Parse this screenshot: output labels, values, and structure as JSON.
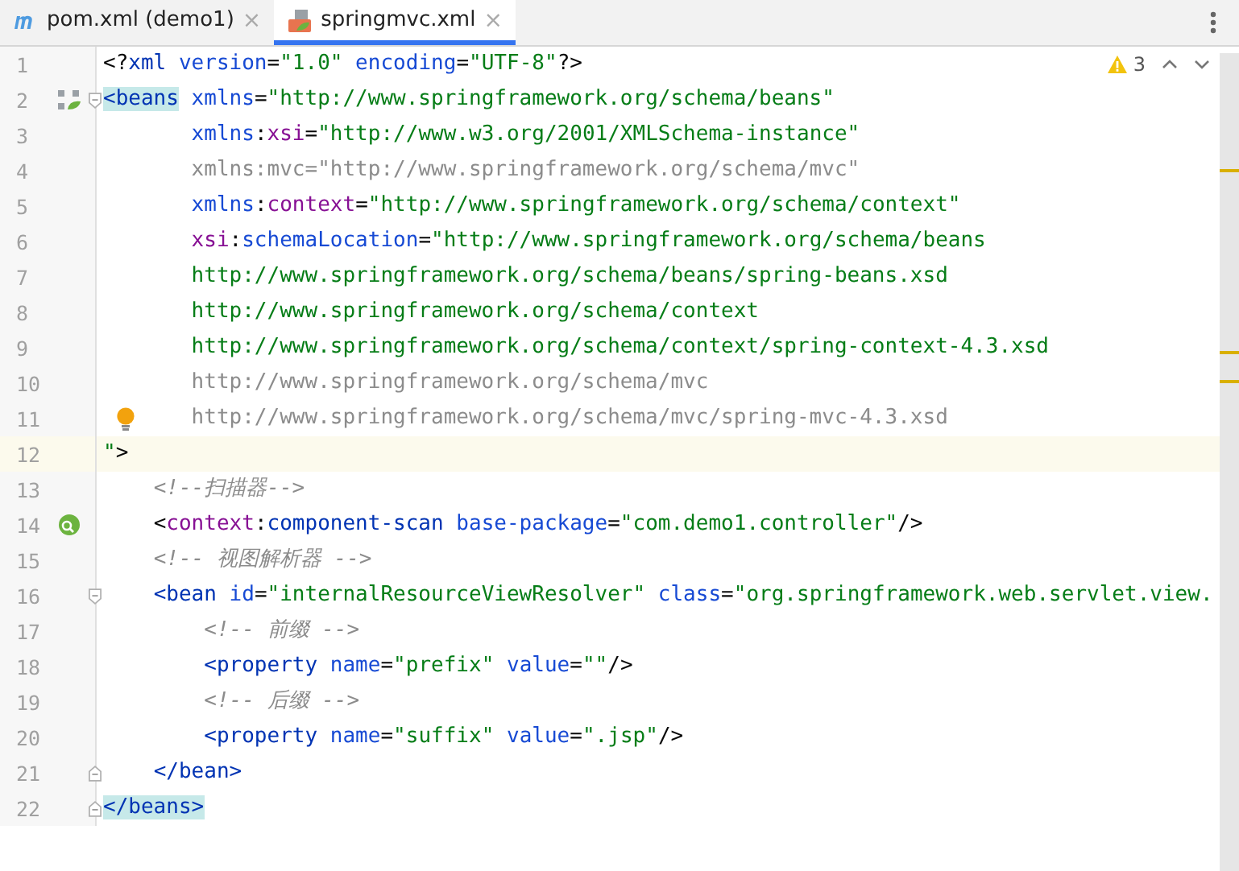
{
  "tabs": [
    {
      "label": "pom.xml (demo1)",
      "kind": "maven",
      "close": "×",
      "selected": false
    },
    {
      "label": "springmvc.xml",
      "kind": "xml",
      "close": "×",
      "selected": true
    }
  ],
  "inspection": {
    "warnings": "3"
  },
  "lines": [
    {
      "number": "1",
      "tokens": [
        {
          "kind": "punct",
          "text": "<?"
        },
        {
          "kind": "tag",
          "text": "xml"
        },
        {
          "kind": "attr",
          "text": " version"
        },
        {
          "kind": "punct",
          "text": "="
        },
        {
          "kind": "value",
          "text": "\"1.0\""
        },
        {
          "kind": "attr",
          "text": " encoding"
        },
        {
          "kind": "punct",
          "text": "="
        },
        {
          "kind": "value",
          "text": "\"UTF-8\""
        },
        {
          "kind": "punct",
          "text": "?>"
        }
      ]
    },
    {
      "number": "2",
      "gutter": {
        "kind": "bean"
      },
      "fold": {
        "kind": "start"
      },
      "tokens": [
        {
          "kind": "tag_match",
          "text": "<beans"
        },
        {
          "kind": "attr",
          "text": " xmlns"
        },
        {
          "kind": "punct",
          "text": "="
        },
        {
          "kind": "value",
          "text": "\"http://www.springframework.org/schema/beans\""
        }
      ]
    },
    {
      "number": "3",
      "tokens": [
        {
          "kind": "attr",
          "text": "       xmlns"
        },
        {
          "kind": "punct",
          "text": ":"
        },
        {
          "kind": "ns",
          "text": "xsi"
        },
        {
          "kind": "punct",
          "text": "="
        },
        {
          "kind": "value",
          "text": "\"http://www.w3.org/2001/XMLSchema-instance\""
        }
      ]
    },
    {
      "number": "4",
      "tokens": [
        {
          "kind": "unused",
          "text": "       xmlns:mvc=\"http://www.springframework.org/schema/mvc\""
        }
      ]
    },
    {
      "number": "5",
      "tokens": [
        {
          "kind": "attr",
          "text": "       xmlns"
        },
        {
          "kind": "punct",
          "text": ":"
        },
        {
          "kind": "ns",
          "text": "context"
        },
        {
          "kind": "punct",
          "text": "="
        },
        {
          "kind": "value",
          "text": "\"http://www.springframework.org/schema/context\""
        }
      ]
    },
    {
      "number": "6",
      "tokens": [
        {
          "kind": "ns",
          "text": "       xsi"
        },
        {
          "kind": "punct",
          "text": ":"
        },
        {
          "kind": "attr",
          "text": "schemaLocation"
        },
        {
          "kind": "punct",
          "text": "="
        },
        {
          "kind": "value",
          "text": "\"http://www.springframework.org/schema/beans"
        }
      ]
    },
    {
      "number": "7",
      "tokens": [
        {
          "kind": "value",
          "text": "       http://www.springframework.org/schema/beans/spring-beans.xsd"
        }
      ]
    },
    {
      "number": "8",
      "tokens": [
        {
          "kind": "value",
          "text": "       http://www.springframework.org/schema/context"
        }
      ]
    },
    {
      "number": "9",
      "tokens": [
        {
          "kind": "value",
          "text": "       http://www.springframework.org/schema/context/spring-context-4.3.xsd"
        }
      ]
    },
    {
      "number": "10",
      "tokens": [
        {
          "kind": "unused",
          "text": "       http://www.springframework.org/schema/mvc"
        }
      ]
    },
    {
      "number": "11",
      "gutter": {
        "kind": "bulb"
      },
      "tokens": [
        {
          "kind": "unused",
          "text": "       http://www.springframework.org/schema/mvc/spring-mvc-4.3.xsd"
        }
      ]
    },
    {
      "number": "12",
      "current": true,
      "tokens": [
        {
          "kind": "value",
          "text": "\""
        },
        {
          "kind": "punct",
          "text": ">"
        }
      ]
    },
    {
      "number": "13",
      "tokens": [
        {
          "kind": "comment",
          "text": "    <!--扫描器-->"
        }
      ]
    },
    {
      "number": "14",
      "gutter": {
        "kind": "scan"
      },
      "tokens": [
        {
          "kind": "punct",
          "text": "    <"
        },
        {
          "kind": "ns",
          "text": "context"
        },
        {
          "kind": "punct",
          "text": ":"
        },
        {
          "kind": "tag",
          "text": "component-scan"
        },
        {
          "kind": "attr",
          "text": " base-package"
        },
        {
          "kind": "punct",
          "text": "="
        },
        {
          "kind": "value",
          "text": "\"com.demo1.controller\""
        },
        {
          "kind": "punct",
          "text": "/>"
        }
      ]
    },
    {
      "number": "15",
      "tokens": [
        {
          "kind": "comment",
          "text": "    <!-- 视图解析器 -->"
        }
      ]
    },
    {
      "number": "16",
      "fold": {
        "kind": "start"
      },
      "tokens": [
        {
          "kind": "tag",
          "text": "    <bean"
        },
        {
          "kind": "attr",
          "text": " id"
        },
        {
          "kind": "punct",
          "text": "="
        },
        {
          "kind": "value",
          "text": "\"internalResourceViewResolver\""
        },
        {
          "kind": "attr",
          "text": " class"
        },
        {
          "kind": "punct",
          "text": "="
        },
        {
          "kind": "value",
          "text": "\"org.springframework.web.servlet.view."
        }
      ]
    },
    {
      "number": "17",
      "tokens": [
        {
          "kind": "comment",
          "text": "        <!-- 前缀 -->"
        }
      ]
    },
    {
      "number": "18",
      "tokens": [
        {
          "kind": "tag",
          "text": "        <property"
        },
        {
          "kind": "attr",
          "text": " name"
        },
        {
          "kind": "punct",
          "text": "="
        },
        {
          "kind": "value",
          "text": "\"prefix\""
        },
        {
          "kind": "attr",
          "text": " value"
        },
        {
          "kind": "punct",
          "text": "="
        },
        {
          "kind": "value",
          "text": "\"\""
        },
        {
          "kind": "punct",
          "text": "/>"
        }
      ]
    },
    {
      "number": "19",
      "tokens": [
        {
          "kind": "comment",
          "text": "        <!-- 后缀 -->"
        }
      ]
    },
    {
      "number": "20",
      "tokens": [
        {
          "kind": "tag",
          "text": "        <property"
        },
        {
          "kind": "attr",
          "text": " name"
        },
        {
          "kind": "punct",
          "text": "="
        },
        {
          "kind": "value",
          "text": "\"suffix\""
        },
        {
          "kind": "attr",
          "text": " value"
        },
        {
          "kind": "punct",
          "text": "="
        },
        {
          "kind": "value",
          "text": "\".jsp\""
        },
        {
          "kind": "punct",
          "text": "/>"
        }
      ]
    },
    {
      "number": "21",
      "fold": {
        "kind": "end"
      },
      "tokens": [
        {
          "kind": "tag",
          "text": "    </bean>"
        }
      ]
    },
    {
      "number": "22",
      "fold": {
        "kind": "end"
      },
      "tokens": [
        {
          "kind": "tag_match",
          "text": "</beans>"
        }
      ]
    }
  ]
}
